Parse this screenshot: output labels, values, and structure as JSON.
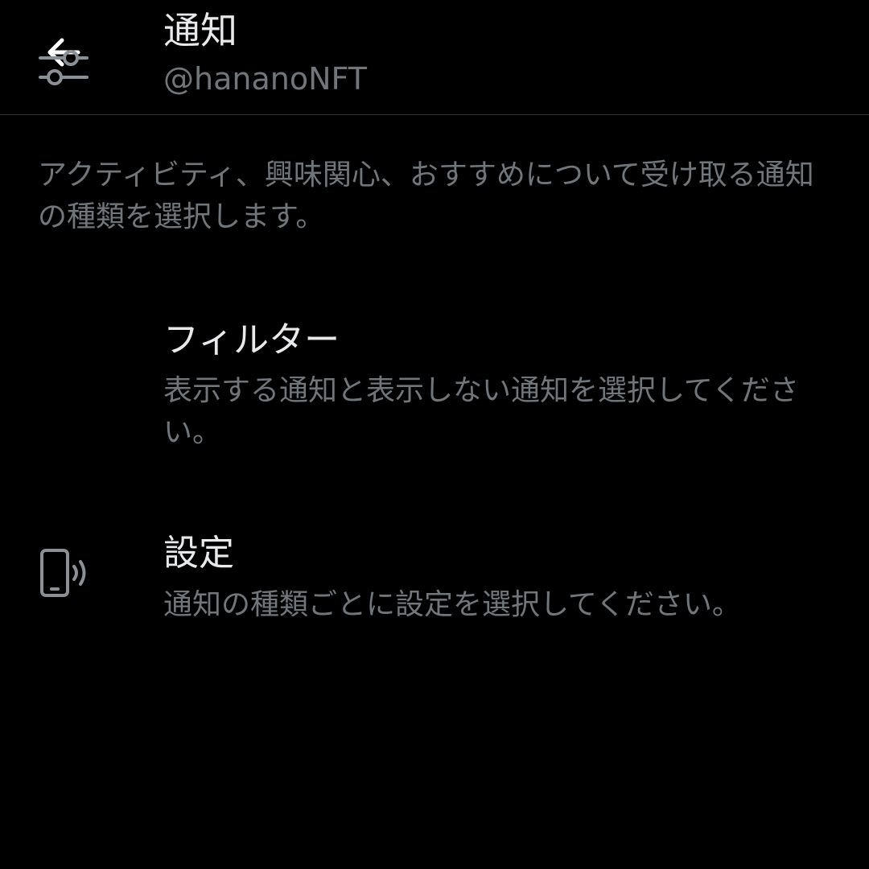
{
  "header": {
    "title": "通知",
    "subtitle": "@hananoNFT"
  },
  "description": "アクティビティ、興味関心、おすすめについて受け取る通知の種類を選択します。",
  "items": [
    {
      "icon": "filter-sliders-icon",
      "title": "フィルター",
      "description": "表示する通知と表示しない通知を選択してください。"
    },
    {
      "icon": "phone-vibrate-icon",
      "title": "設定",
      "description": "通知の種類ごとに設定を選択してください。"
    }
  ],
  "colors": {
    "background": "#000000",
    "primary_text": "#e7e9ea",
    "secondary_text": "#71767b",
    "divider": "#2f3336"
  }
}
